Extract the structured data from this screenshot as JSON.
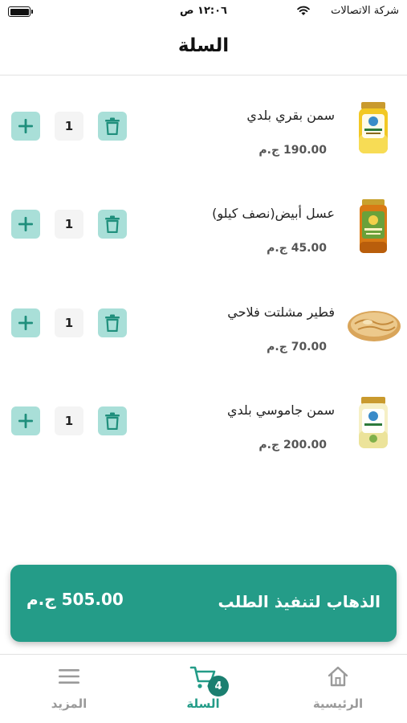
{
  "status_bar": {
    "carrier": "شركة الاتصالات",
    "time": "١٢:٠٦ ص",
    "wifi_icon": "wifi-icon",
    "battery_icon": "battery-icon"
  },
  "header": {
    "title": "السلة"
  },
  "cart": {
    "items": [
      {
        "name": "سمن بقري بلدي",
        "price": "190.00 ج.م",
        "quantity": "1",
        "image_icon": "ghee-jar-image"
      },
      {
        "name": "عسل أبيض(نصف كيلو)",
        "price": "45.00 ج.م",
        "quantity": "1",
        "image_icon": "honey-jar-image"
      },
      {
        "name": "فطير مشلتت فلاحي",
        "price": "70.00 ج.م",
        "quantity": "1",
        "image_icon": "pastry-image"
      },
      {
        "name": "سمن جاموسي بلدي",
        "price": "200.00 ج.م",
        "quantity": "1",
        "image_icon": "buffalo-ghee-jar-image"
      }
    ],
    "item_icons": {
      "increase": "plus-icon",
      "remove": "trash-icon"
    }
  },
  "checkout": {
    "label": "الذهاب لتنفيذ الطلب",
    "total": "505.00 ج.م"
  },
  "tab_bar": {
    "tabs": [
      {
        "label": "الرئيسية",
        "icon": "home-icon",
        "active": false
      },
      {
        "label": "السلة",
        "icon": "cart-icon",
        "active": true
      },
      {
        "label": "المزيد",
        "icon": "menu-icon",
        "active": false
      }
    ],
    "cart_badge": "4"
  },
  "colors": {
    "accent": "#249c88",
    "button_tint": "#a9dfd8",
    "badge": "#1b7f70"
  }
}
